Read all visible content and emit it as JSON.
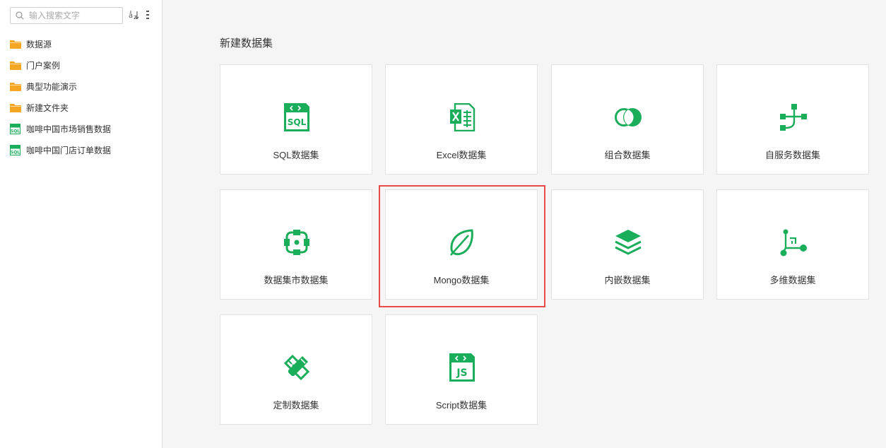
{
  "sidebar": {
    "search": {
      "placeholder": "输入搜索文字"
    },
    "items": [
      {
        "label": "数据源",
        "icon": "folder-icon"
      },
      {
        "label": "门户案例",
        "icon": "folder-icon"
      },
      {
        "label": "典型功能演示",
        "icon": "folder-icon"
      },
      {
        "label": "新建文件夹",
        "icon": "folder-icon"
      },
      {
        "label": "咖啡中国市场销售数据",
        "icon": "sql-dataset-icon"
      },
      {
        "label": "咖啡中国门店订单数据",
        "icon": "sql-dataset-icon"
      }
    ]
  },
  "main": {
    "title": "新建数据集",
    "cards": [
      {
        "label": "SQL数据集",
        "icon": "sql-icon"
      },
      {
        "label": "Excel数据集",
        "icon": "excel-icon"
      },
      {
        "label": "组合数据集",
        "icon": "combine-icon"
      },
      {
        "label": "自服务数据集",
        "icon": "self-service-icon"
      },
      {
        "label": "数据集市数据集",
        "icon": "data-mart-icon"
      },
      {
        "label": "Mongo数据集",
        "icon": "mongo-leaf-icon"
      },
      {
        "label": "内嵌数据集",
        "icon": "embedded-layers-icon"
      },
      {
        "label": "多维数据集",
        "icon": "multidimensional-icon"
      },
      {
        "label": "定制数据集",
        "icon": "custom-pencil-icon"
      },
      {
        "label": "Script数据集",
        "icon": "script-js-icon"
      }
    ],
    "highlighted_card": "Mongo数据集"
  },
  "colors": {
    "accent": "#1aad5a",
    "folder": "#f5a623",
    "highlight": "#e84a4a"
  }
}
